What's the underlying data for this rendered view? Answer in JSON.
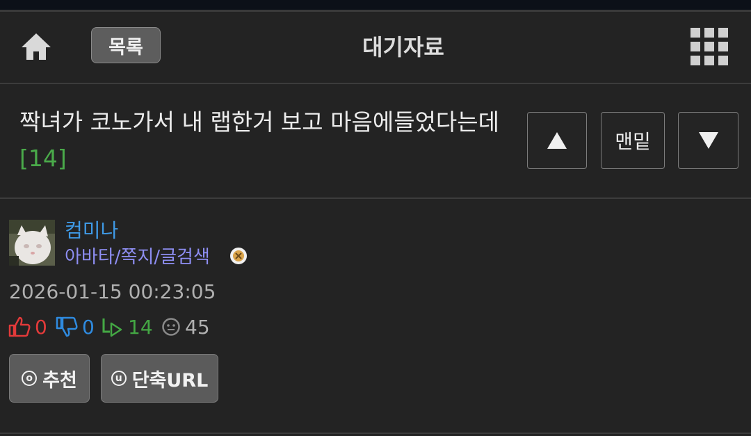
{
  "header": {
    "home_icon": "home-icon",
    "list_label": "목록",
    "title": "대기자료",
    "menu_icon": "grid-menu-icon"
  },
  "post": {
    "title": "짝녀가 코노가서 내 랩한거 보고 마음에들었다는데",
    "comment_count": "[14]",
    "nav": {
      "up_icon": "arrow-up-icon",
      "bottom_label": "맨밑",
      "down_icon": "arrow-down-icon"
    }
  },
  "author": {
    "name": "컴미나",
    "links": "아바타/쪽지/글검색",
    "badge_icon": "level-badge-icon"
  },
  "date": "2026-01-15 00:23:05",
  "stats": {
    "likes": "0",
    "dislikes": "0",
    "comments": "14",
    "views": "45"
  },
  "actions": {
    "recommend_label": "추천",
    "recommend_icon": "o",
    "shorturl_label": "단축URL",
    "shorturl_icon": "u"
  },
  "colors": {
    "background": "#232323",
    "button_bg": "#5b5b5b",
    "like": "#e23a3a",
    "dislike": "#2f8be0",
    "comments": "#44a844",
    "username": "#3f9ae6",
    "links": "#8e8ef2"
  }
}
